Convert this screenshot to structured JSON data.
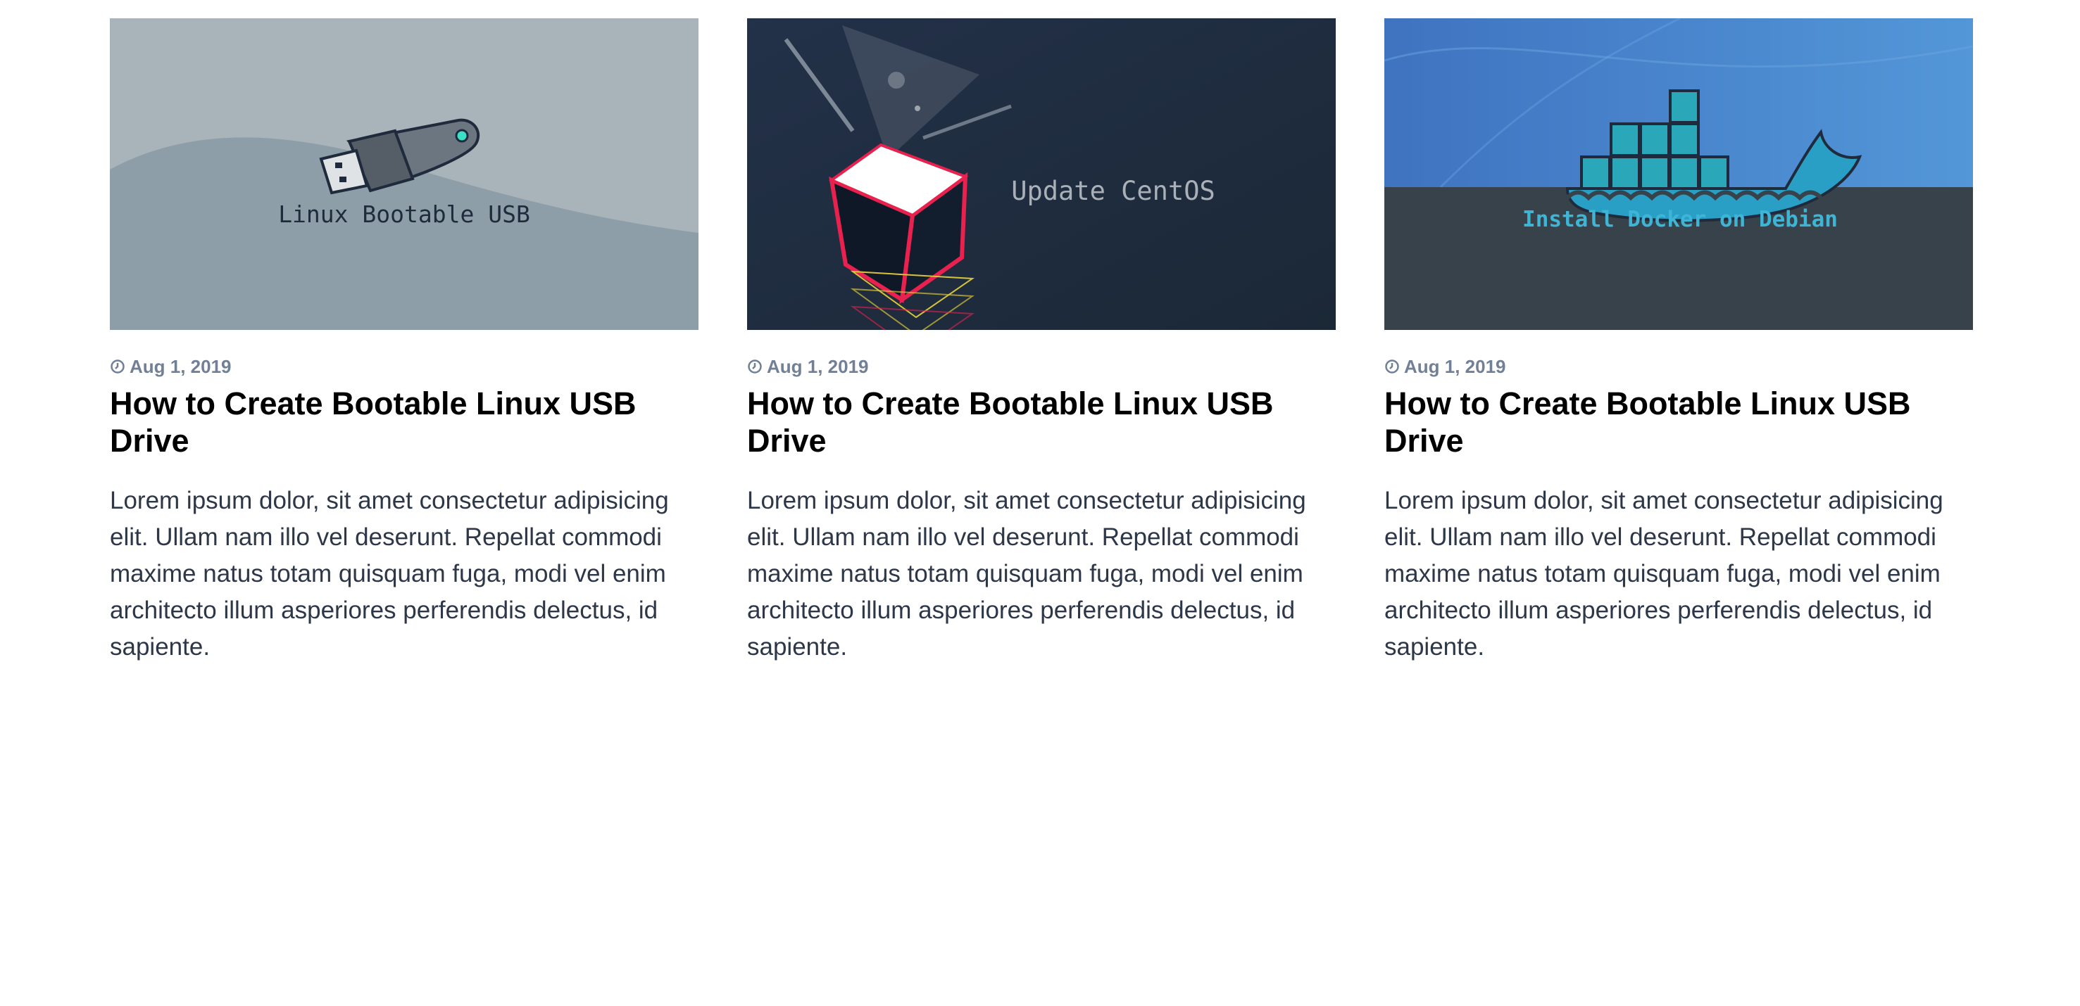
{
  "posts": [
    {
      "image": {
        "caption": "Linux Bootable USB",
        "icon": "usb-drive-illustration",
        "colors": {
          "bg": "#a8b3ba",
          "hill": "#8e9ea8",
          "text": "#1f2b3c"
        }
      },
      "date": "Aug 1, 2019",
      "title": "How to Create Bootable Linux USB Drive",
      "excerpt": "Lorem ipsum dolor, sit amet consectetur adipisicing elit. Ullam nam illo vel deserunt. Repellat commodi maxime natus totam quisquam fuga, modi vel enim architecto illum asperiores perferendis delectus, id sapiente."
    },
    {
      "image": {
        "caption": "Update CentOS",
        "icon": "glowing-cube-illustration",
        "colors": {
          "bg": "#1e2a3b",
          "text": "#a9b0b8",
          "accent": "#e8214f"
        }
      },
      "date": "Aug 1, 2019",
      "title": "How to Create Bootable Linux USB Drive",
      "excerpt": "Lorem ipsum dolor, sit amet consectetur adipisicing elit. Ullam nam illo vel deserunt. Repellat commodi maxime natus totam quisquam fuga, modi vel enim architecto illum asperiores perferendis delectus, id sapiente."
    },
    {
      "image": {
        "caption": "Install Docker on Debian",
        "icon": "docker-whale-illustration",
        "colors": {
          "sky": "#4a86cc",
          "ground": "#37424a",
          "text": "#3fb5d6"
        }
      },
      "date": "Aug 1, 2019",
      "title": "How to Create Bootable Linux USB Drive",
      "excerpt": "Lorem ipsum dolor, sit amet consectetur adipisicing elit. Ullam nam illo vel deserunt. Repellat commodi maxime natus totam quisquam fuga, modi vel enim architecto illum asperiores perferendis delectus, id sapiente."
    }
  ],
  "theme": {
    "meta_color": "#718096",
    "title_color": "#000000",
    "body_color": "#2d3748"
  }
}
